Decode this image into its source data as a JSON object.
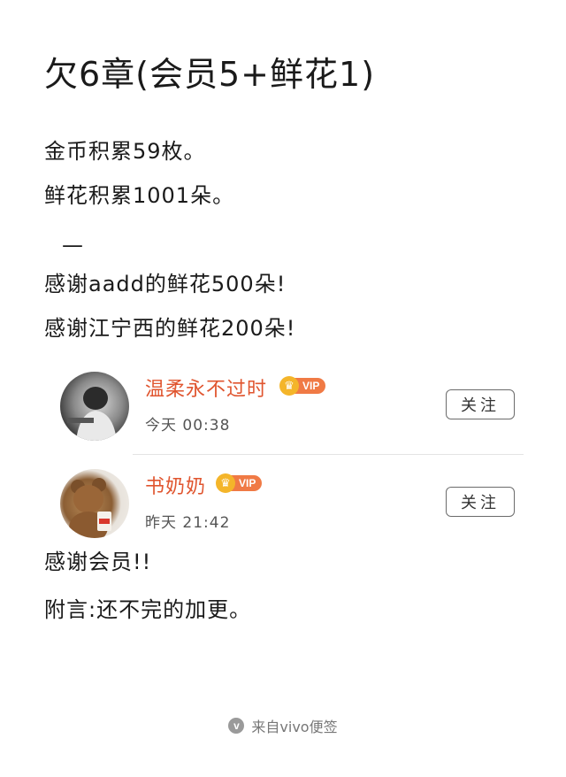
{
  "note": {
    "title": "欠6章(会员5+鲜花1)",
    "lines": [
      "金币积累59枚。",
      "鲜花积累1001朵。",
      "—",
      "感谢aadd的鲜花500朵!",
      "感谢江宁西的鲜花200朵!"
    ],
    "after_lines": [
      "感谢会员!!",
      "附言:还不完的加更。"
    ]
  },
  "comments": [
    {
      "name": "温柔永不过时",
      "badge": "VIP",
      "time": "今天 00:38",
      "follow_label": "关注",
      "avatar": "person-photo"
    },
    {
      "name": "书奶奶",
      "badge": "VIP",
      "time": "昨天 21:42",
      "follow_label": "关注",
      "avatar": "teddy-bear-photo"
    }
  ],
  "footer": {
    "logo": "v",
    "text": "来自vivo便签"
  },
  "colors": {
    "username": "#e0552f",
    "vip_crown": "#f4b52a",
    "vip_tag": "#f07a45"
  }
}
